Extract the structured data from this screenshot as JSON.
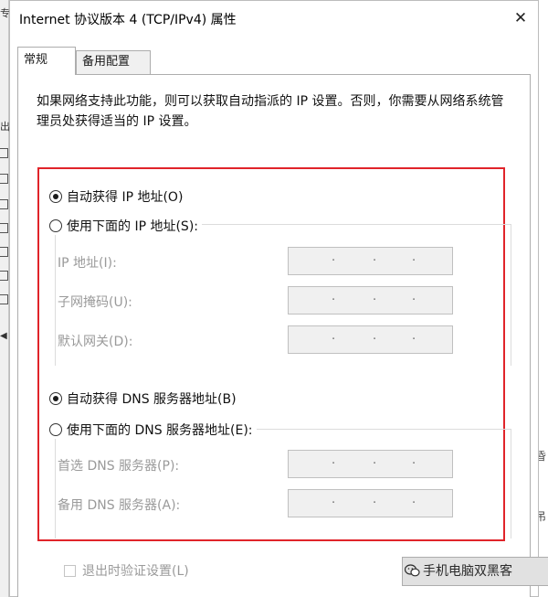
{
  "background": {
    "left_glyphs": [
      "专",
      "出"
    ],
    "right_glyphs": [
      "昏",
      "吊"
    ]
  },
  "dialog": {
    "title": "Internet 协议版本 4 (TCP/IPv4) 属性",
    "close_glyph": "✕",
    "tabs": [
      {
        "label": "常规",
        "active": true
      },
      {
        "label": "备用配置",
        "active": false
      }
    ],
    "description": "如果网络支持此功能，则可以获取自动指派的 IP 设置。否则，你需要从网络系统管理员处获得适当的 IP 设置。",
    "ip_section": {
      "auto_label": "自动获得 IP 地址(O)",
      "auto_selected": true,
      "manual_label": "使用下面的 IP 地址(S):",
      "manual_selected": false,
      "fields": [
        {
          "label": "IP 地址(I):",
          "value": ". . ."
        },
        {
          "label": "子网掩码(U):",
          "value": ". . ."
        },
        {
          "label": "默认网关(D):",
          "value": ". . ."
        }
      ]
    },
    "dns_section": {
      "auto_label": "自动获得 DNS 服务器地址(B)",
      "auto_selected": true,
      "manual_label": "使用下面的 DNS 服务器地址(E):",
      "manual_selected": false,
      "fields": [
        {
          "label": "首选 DNS 服务器(P):",
          "value": ". . ."
        },
        {
          "label": "备用 DNS 服务器(A):",
          "value": ". . ."
        }
      ]
    },
    "validate_label": "退出时验证设置(L)",
    "validate_checked": false,
    "highlight_color": "#e0242a"
  },
  "watermark": {
    "text": "手机电脑双黑客"
  }
}
